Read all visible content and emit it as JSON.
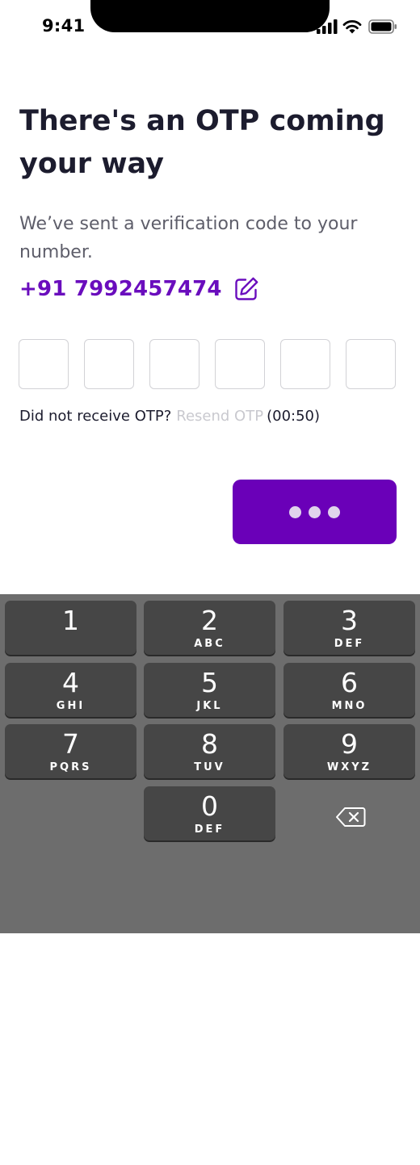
{
  "status_bar": {
    "time": "9:41",
    "icons": [
      "cellular-signal-icon",
      "wifi-icon",
      "battery-icon"
    ]
  },
  "header": {
    "title": "There's an OTP coming your way"
  },
  "message": {
    "text": "We’ve sent a verification code to your number.",
    "phone": "+91 7992457474"
  },
  "otp": {
    "length": 6,
    "values": [
      "",
      "",
      "",
      "",
      "",
      ""
    ]
  },
  "resend": {
    "prompt": "Did not receive OTP?",
    "link": "Resend OTP",
    "timer": "(00:50)"
  },
  "submit": {
    "state": "loading"
  },
  "keypad": {
    "keys": [
      {
        "digit": "1",
        "letters": ""
      },
      {
        "digit": "2",
        "letters": "ABC"
      },
      {
        "digit": "3",
        "letters": "DEF"
      },
      {
        "digit": "4",
        "letters": "GHI"
      },
      {
        "digit": "5",
        "letters": "JKL"
      },
      {
        "digit": "6",
        "letters": "MNO"
      },
      {
        "digit": "7",
        "letters": "PQRS"
      },
      {
        "digit": "8",
        "letters": "TUV"
      },
      {
        "digit": "9",
        "letters": "WXYZ"
      },
      {
        "digit": "0",
        "letters": "DEF"
      }
    ]
  },
  "colors": {
    "accent": "#6a0dbd",
    "button": "#6a00b8",
    "keyboard_bg": "#6d6d6d",
    "key_bg": "#464646"
  }
}
